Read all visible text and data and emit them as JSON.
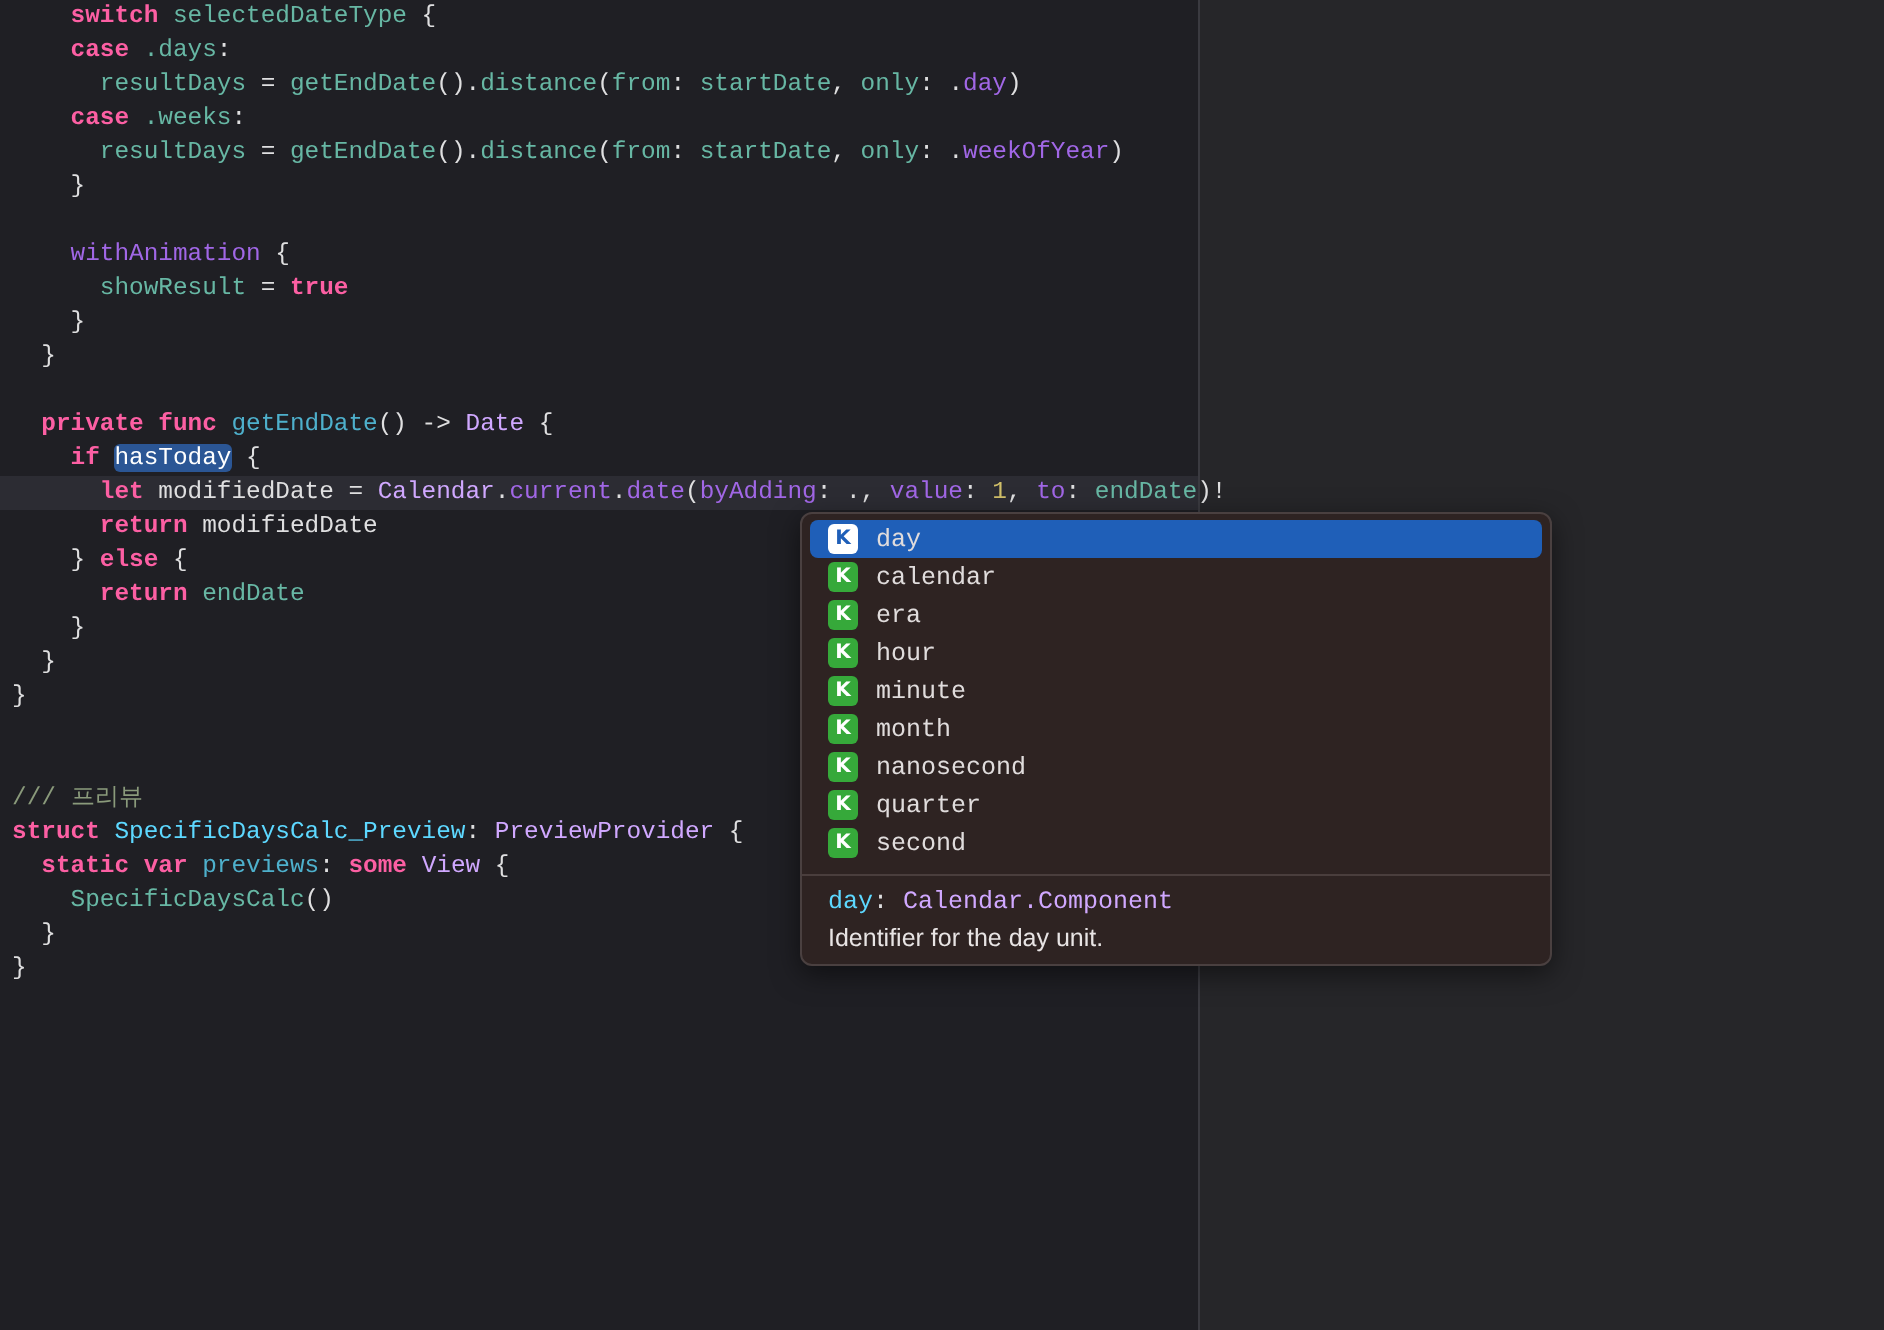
{
  "editor": {
    "lines": [
      {
        "current": false,
        "tokens": [
          {
            "text": "    switch",
            "kind": "keyword"
          },
          {
            "text": " selectedDateType",
            "kind": "ident"
          },
          {
            "text": " {",
            "kind": "plain"
          }
        ]
      },
      {
        "current": false,
        "tokens": [
          {
            "text": "    case",
            "kind": "keyword"
          },
          {
            "text": " .days",
            "kind": "ident"
          },
          {
            "text": ":",
            "kind": "plain"
          }
        ]
      },
      {
        "current": false,
        "tokens": [
          {
            "text": "      resultDays",
            "kind": "ident"
          },
          {
            "text": " = ",
            "kind": "plain"
          },
          {
            "text": "getEndDate",
            "kind": "ident"
          },
          {
            "text": "().",
            "kind": "plain"
          },
          {
            "text": "distance",
            "kind": "ident"
          },
          {
            "text": "(",
            "kind": "plain"
          },
          {
            "text": "from",
            "kind": "ident"
          },
          {
            "text": ": ",
            "kind": "plain"
          },
          {
            "text": "startDate",
            "kind": "ident"
          },
          {
            "text": ", ",
            "kind": "plain"
          },
          {
            "text": "only",
            "kind": "ident"
          },
          {
            "text": ": .",
            "kind": "plain"
          },
          {
            "text": "day",
            "kind": "member"
          },
          {
            "text": ")",
            "kind": "plain"
          }
        ]
      },
      {
        "current": false,
        "tokens": [
          {
            "text": "    case",
            "kind": "keyword"
          },
          {
            "text": " .weeks",
            "kind": "ident"
          },
          {
            "text": ":",
            "kind": "plain"
          }
        ]
      },
      {
        "current": false,
        "tokens": [
          {
            "text": "      resultDays",
            "kind": "ident"
          },
          {
            "text": " = ",
            "kind": "plain"
          },
          {
            "text": "getEndDate",
            "kind": "ident"
          },
          {
            "text": "().",
            "kind": "plain"
          },
          {
            "text": "distance",
            "kind": "ident"
          },
          {
            "text": "(",
            "kind": "plain"
          },
          {
            "text": "from",
            "kind": "ident"
          },
          {
            "text": ": ",
            "kind": "plain"
          },
          {
            "text": "startDate",
            "kind": "ident"
          },
          {
            "text": ", ",
            "kind": "plain"
          },
          {
            "text": "only",
            "kind": "ident"
          },
          {
            "text": ": .",
            "kind": "plain"
          },
          {
            "text": "weekOfYear",
            "kind": "member"
          },
          {
            "text": ")",
            "kind": "plain"
          }
        ]
      },
      {
        "current": false,
        "tokens": [
          {
            "text": "    }",
            "kind": "plain"
          }
        ]
      },
      {
        "current": false
      },
      {
        "current": false,
        "tokens": [
          {
            "text": "    withAnimation",
            "kind": "member"
          },
          {
            "text": " {",
            "kind": "plain"
          }
        ]
      },
      {
        "current": false,
        "tokens": [
          {
            "text": "      showResult",
            "kind": "ident"
          },
          {
            "text": " = ",
            "kind": "plain"
          },
          {
            "text": "true",
            "kind": "keyword"
          }
        ]
      },
      {
        "current": false,
        "tokens": [
          {
            "text": "    }",
            "kind": "plain"
          }
        ]
      },
      {
        "current": false,
        "tokens": [
          {
            "text": "  }",
            "kind": "plain"
          }
        ]
      },
      {
        "current": false
      },
      {
        "current": false,
        "tokens": [
          {
            "text": "  private func",
            "kind": "keyword"
          },
          {
            "text": " getEndDate",
            "kind": "decl"
          },
          {
            "text": "() -> ",
            "kind": "plain"
          },
          {
            "text": "Date",
            "kind": "type"
          },
          {
            "text": " {",
            "kind": "plain"
          }
        ]
      },
      {
        "current": false,
        "tokens": [
          {
            "text": "    if ",
            "kind": "keyword"
          },
          {
            "text": "hasToday",
            "kind": "selection"
          },
          {
            "text": " {",
            "kind": "plain"
          }
        ]
      },
      {
        "current": true,
        "tokens": [
          {
            "text": "      let",
            "kind": "keyword"
          },
          {
            "text": " modifiedDate = ",
            "kind": "plain"
          },
          {
            "text": "Calendar",
            "kind": "type"
          },
          {
            "text": ".",
            "kind": "plain"
          },
          {
            "text": "current",
            "kind": "member"
          },
          {
            "text": ".",
            "kind": "plain"
          },
          {
            "text": "date",
            "kind": "member"
          },
          {
            "text": "(",
            "kind": "plain"
          },
          {
            "text": "byAdding",
            "kind": "member"
          },
          {
            "text": ": ., ",
            "kind": "plain"
          },
          {
            "text": "value",
            "kind": "member"
          },
          {
            "text": ": ",
            "kind": "plain"
          },
          {
            "text": "1",
            "kind": "number"
          },
          {
            "text": ", ",
            "kind": "plain"
          },
          {
            "text": "to",
            "kind": "member"
          },
          {
            "text": ": ",
            "kind": "plain"
          },
          {
            "text": "endDate",
            "kind": "ident"
          },
          {
            "text": ")!",
            "kind": "plain"
          }
        ]
      },
      {
        "current": false,
        "tokens": [
          {
            "text": "      return",
            "kind": "keyword"
          },
          {
            "text": " modifiedDate",
            "kind": "plain"
          }
        ]
      },
      {
        "current": false,
        "tokens": [
          {
            "text": "    } ",
            "kind": "plain"
          },
          {
            "text": "else",
            "kind": "keyword"
          },
          {
            "text": " {",
            "kind": "plain"
          }
        ]
      },
      {
        "current": false,
        "tokens": [
          {
            "text": "      return",
            "kind": "keyword"
          },
          {
            "text": " endDate",
            "kind": "ident"
          }
        ]
      },
      {
        "current": false,
        "tokens": [
          {
            "text": "    }",
            "kind": "plain"
          }
        ]
      },
      {
        "current": false,
        "tokens": [
          {
            "text": "  }",
            "kind": "plain"
          }
        ]
      },
      {
        "current": false,
        "tokens": [
          {
            "text": "}",
            "kind": "plain"
          }
        ]
      },
      {
        "current": false
      },
      {
        "current": false
      },
      {
        "current": false,
        "tokens": [
          {
            "text": "/// 프리뷰",
            "kind": "comment"
          }
        ]
      },
      {
        "current": false,
        "tokens": [
          {
            "text": "struct",
            "kind": "keyword"
          },
          {
            "text": " SpecificDaysCalc_Preview",
            "kind": "typedecl"
          },
          {
            "text": ": ",
            "kind": "plain"
          },
          {
            "text": "PreviewProvider",
            "kind": "type"
          },
          {
            "text": " {",
            "kind": "plain"
          }
        ]
      },
      {
        "current": false,
        "tokens": [
          {
            "text": "  static var",
            "kind": "keyword"
          },
          {
            "text": " previews",
            "kind": "decl"
          },
          {
            "text": ": ",
            "kind": "plain"
          },
          {
            "text": "some ",
            "kind": "keyword"
          },
          {
            "text": "View",
            "kind": "type"
          },
          {
            "text": " {",
            "kind": "plain"
          }
        ]
      },
      {
        "current": false,
        "tokens": [
          {
            "text": "    SpecificDaysCalc",
            "kind": "ident"
          },
          {
            "text": "()",
            "kind": "plain"
          }
        ]
      },
      {
        "current": false,
        "tokens": [
          {
            "text": "  }",
            "kind": "plain"
          }
        ]
      },
      {
        "current": false,
        "tokens": [
          {
            "text": "}",
            "kind": "plain"
          }
        ]
      }
    ]
  },
  "completion": {
    "items": [
      {
        "badge": "K",
        "label": "day",
        "selected": true
      },
      {
        "badge": "K",
        "label": "calendar",
        "selected": false
      },
      {
        "badge": "K",
        "label": "era",
        "selected": false
      },
      {
        "badge": "K",
        "label": "hour",
        "selected": false
      },
      {
        "badge": "K",
        "label": "minute",
        "selected": false
      },
      {
        "badge": "K",
        "label": "month",
        "selected": false
      },
      {
        "badge": "K",
        "label": "nanosecond",
        "selected": false
      },
      {
        "badge": "K",
        "label": "quarter",
        "selected": false
      },
      {
        "badge": "K",
        "label": "second",
        "selected": false
      }
    ],
    "detail": {
      "name": "day",
      "separator": ": ",
      "type": "Calendar.Component",
      "description": "Identifier for the day unit."
    }
  }
}
